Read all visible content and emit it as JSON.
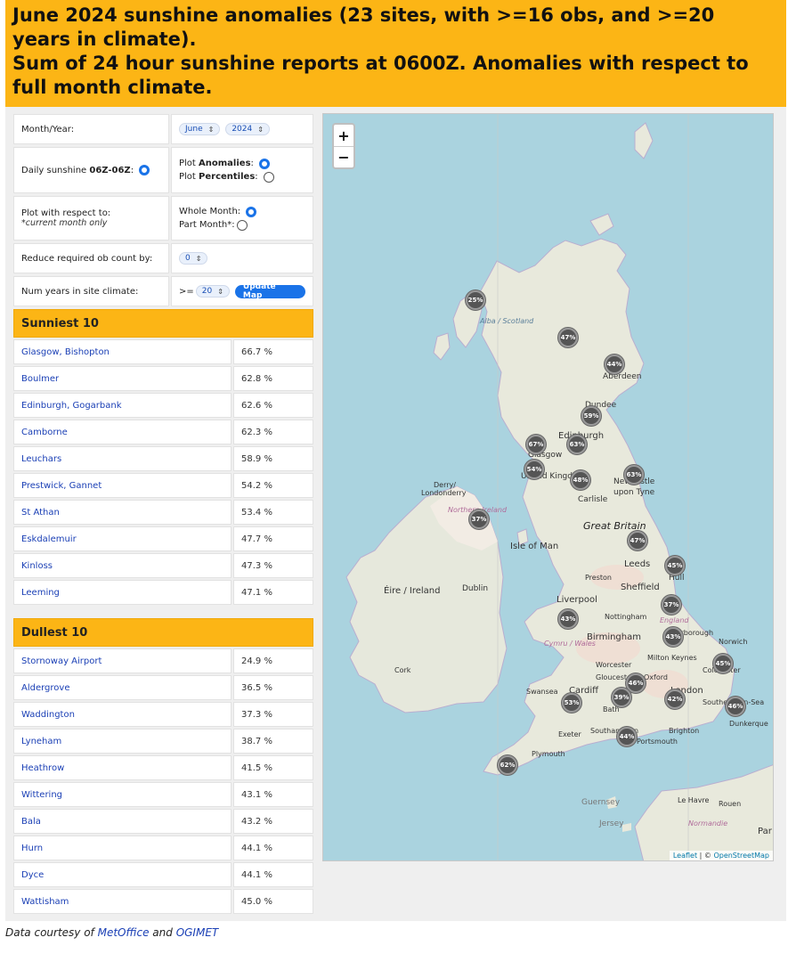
{
  "header": {
    "lines": [
      "June 2024 sunshine anomalies (23 sites, with >=16 obs, and >=20",
      "years in climate).",
      "Sum of 24 hour sunshine reports at 0600Z. Anomalies with respect to",
      "full month climate."
    ]
  },
  "controls": {
    "month_year_label": "Month/Year:",
    "month_value": "June",
    "year_value": "2024",
    "daily_sunshine_prefix": "Daily sunshine ",
    "daily_sunshine_bold": "06Z-06Z",
    "plot_prefix": "Plot ",
    "plot_anomalies_bold": "Anomalies",
    "plot_percentiles_bold": "Percentiles",
    "respect_label": "Plot with respect to:",
    "respect_note": "*current month only",
    "whole_month": "Whole Month:",
    "part_month": "Part Month*:",
    "reduce_label": "Reduce required ob count by:",
    "reduce_value": "0",
    "num_years_label": "Num years in site climate:",
    "num_years_prefix": ">=",
    "num_years_value": "20",
    "update_button": "Update Map"
  },
  "sunniest": {
    "title": "Sunniest 10",
    "rows": [
      {
        "name": "Glasgow, Bishopton",
        "value": "66.7 %"
      },
      {
        "name": "Boulmer",
        "value": "62.8 %"
      },
      {
        "name": "Edinburgh, Gogarbank",
        "value": "62.6 %"
      },
      {
        "name": "Camborne",
        "value": "62.3 %"
      },
      {
        "name": "Leuchars",
        "value": "58.9 %"
      },
      {
        "name": "Prestwick, Gannet",
        "value": "54.2 %"
      },
      {
        "name": "St Athan",
        "value": "53.4 %"
      },
      {
        "name": "Eskdalemuir",
        "value": "47.7 %"
      },
      {
        "name": "Kinloss",
        "value": "47.3 %"
      },
      {
        "name": "Leeming",
        "value": "47.1 %"
      }
    ]
  },
  "dullest": {
    "title": "Dullest 10",
    "rows": [
      {
        "name": "Stornoway Airport",
        "value": "24.9 %"
      },
      {
        "name": "Aldergrove",
        "value": "36.5 %"
      },
      {
        "name": "Waddington",
        "value": "37.3 %"
      },
      {
        "name": "Lyneham",
        "value": "38.7 %"
      },
      {
        "name": "Heathrow",
        "value": "41.5 %"
      },
      {
        "name": "Wittering",
        "value": "43.1 %"
      },
      {
        "name": "Bala",
        "value": "43.2 %"
      },
      {
        "name": "Hurn",
        "value": "44.1 %"
      },
      {
        "name": "Dyce",
        "value": "44.1 %"
      },
      {
        "name": "Wattisham",
        "value": "45.0 %"
      }
    ]
  },
  "map": {
    "zoom_in": "+",
    "zoom_out": "−",
    "attribution_leaflet": "Leaflet",
    "attribution_sep": " | © ",
    "attribution_osm": "OpenStreetMap",
    "labels": {
      "moray_scotland": "Alba / Scotland",
      "aberdeen": "Aberdeen",
      "dundee": "Dundee",
      "edinburgh": "Edinburgh",
      "glasgow": "Glasgow",
      "united_kingdom": "United Kingdom",
      "newcastle": "Newcastle",
      "newcastle2": "upon Tyne",
      "carlisle": "Carlisle",
      "derry": "Derry/",
      "londonderry": "Londonderry",
      "northern_ireland": "Northern Ireland",
      "great_britain": "Great Britain",
      "isle_of_man": "Isle of Man",
      "leeds": "Leeds",
      "hull": "Hull",
      "preston": "Preston",
      "sheffield": "Sheffield",
      "liverpool": "Liverpool",
      "eire": "Éire / Ireland",
      "dublin": "Dublin",
      "nottingham": "Nottingham",
      "england": "England",
      "birmingham": "Birmingham",
      "peterborough": "Peterborough",
      "norwich": "Norwich",
      "cymru": "Cymru / Wales",
      "cork": "Cork",
      "worcester": "Worcester",
      "milton": "Milton Keynes",
      "colchester": "Colchester",
      "cambridge": "Cambridge",
      "swansea": "Swansea",
      "cardiff": "Cardiff",
      "gloucester": "Gloucester",
      "oxford": "Oxford",
      "london": "London",
      "bath": "Bath",
      "southend": "Southend-on-Sea",
      "exeter": "Exeter",
      "southampton": "Southampton",
      "portsmouth": "Portsmouth",
      "brighton": "Brighton",
      "dunkerque": "Dunkerque",
      "plymouth": "Plymouth",
      "guernsey": "Guernsey",
      "jersey": "Jersey",
      "le_havre": "Le Havre",
      "rouen": "Rouen",
      "normandie": "Normandie",
      "paris": "Par"
    },
    "markers": [
      "25%",
      "47%",
      "44%",
      "59%",
      "67%",
      "63%",
      "54%",
      "48%",
      "63%",
      "37%",
      "47%",
      "45%",
      "37%",
      "43%",
      "43%",
      "45%",
      "46%",
      "39%",
      "42%",
      "46%",
      "53%",
      "44%",
      "62%"
    ]
  },
  "footer": {
    "prefix": "Data courtesy of ",
    "link1": "MetOffice",
    "mid": " and ",
    "link2": "OGIMET"
  },
  "colors": {
    "header_bg": "#fcb515",
    "link": "#1a3fb5",
    "button": "#1a73e8",
    "sea": "#aad3df",
    "land": "#e9eadf"
  }
}
